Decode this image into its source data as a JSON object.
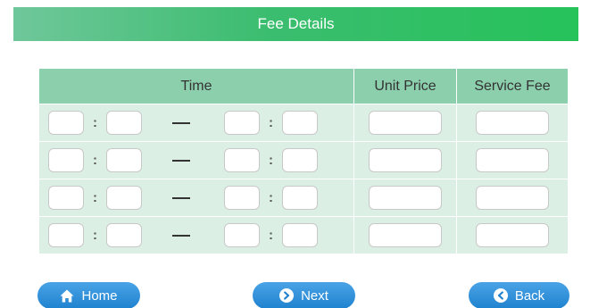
{
  "header": {
    "title": "Fee Details"
  },
  "table": {
    "headers": {
      "time": "Time",
      "unit_price": "Unit Price",
      "service_fee": "Service Fee"
    },
    "rows": [
      {
        "start_hour": "",
        "start_min": "",
        "end_hour": "",
        "end_min": "",
        "unit_price": "",
        "service_fee": ""
      },
      {
        "start_hour": "",
        "start_min": "",
        "end_hour": "",
        "end_min": "",
        "unit_price": "",
        "service_fee": ""
      },
      {
        "start_hour": "",
        "start_min": "",
        "end_hour": "",
        "end_min": "",
        "unit_price": "",
        "service_fee": ""
      },
      {
        "start_hour": "",
        "start_min": "",
        "end_hour": "",
        "end_min": "",
        "unit_price": "",
        "service_fee": ""
      }
    ],
    "colon": ":"
  },
  "buttons": {
    "home": {
      "label": "Home",
      "icon": "home-icon"
    },
    "next": {
      "label": "Next",
      "icon": "arrow-right-circle-icon"
    },
    "back": {
      "label": "Back",
      "icon": "arrow-left-circle-icon"
    }
  },
  "colors": {
    "header_start": "#6fc79a",
    "header_end": "#26c25a",
    "table_header": "#8ccfad",
    "table_row": "#dcefe4",
    "button": "#1f82cf"
  }
}
